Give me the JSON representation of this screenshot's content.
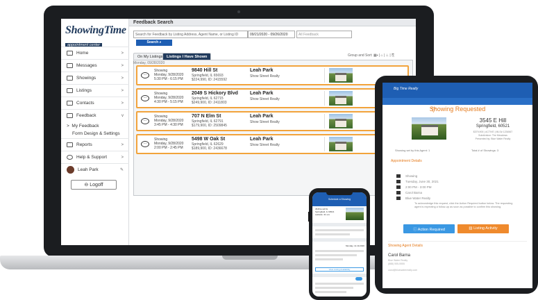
{
  "app": {
    "logo_main": "ShowingTime",
    "logo_sub": "appointment center",
    "page_title": "Feedback Search"
  },
  "sidebar": {
    "items": [
      {
        "label": "Home",
        "icon": "home-icon"
      },
      {
        "label": "Messages",
        "icon": "mail-icon"
      },
      {
        "label": "Showings",
        "icon": "calendar-icon"
      },
      {
        "label": "Listings",
        "icon": "listing-icon"
      },
      {
        "label": "Contacts",
        "icon": "contacts-icon"
      },
      {
        "label": "Feedback",
        "icon": "feedback-icon"
      }
    ],
    "sub_items": [
      "My Feedback",
      "Form Design & Settings"
    ],
    "items2": [
      {
        "label": "Reports",
        "icon": "reports-icon"
      },
      {
        "label": "Help & Support",
        "icon": "help-icon"
      }
    ],
    "user": "Leah Park",
    "logoff": "Logoff"
  },
  "search": {
    "placeholder": "Search for Feedback by Listing Address, Agent Name, or Listing ID",
    "date_range": "09/21/2020 - 09/26/2020",
    "filter_value": "All Feedback",
    "button": "Search"
  },
  "tabs": {
    "on_my_listings": "On My Listings",
    "listings_i_have_shown": "Listings I Have Shown"
  },
  "group_sort": "Group and Sort:",
  "day_label": "Monday, 09/28/2020",
  "cards": [
    {
      "status": "Showing",
      "date": "Monday, 9/28/2020",
      "time": "5:30 PM - 6:15 PM",
      "address": "9840 Hill St",
      "city": "Springfield, IL 65693",
      "price": "$224,990, ID: 2415592",
      "agent": "Leah Park",
      "office": "Show Street Realty"
    },
    {
      "status": "Showing",
      "date": "Monday, 9/28/2020",
      "time": "4:30 PM - 5:15 PM",
      "address": "2049 S Hickory Blvd",
      "city": "Springfield, IL 62715",
      "price": "$249,900, ID: 2411803",
      "agent": "Leah Park",
      "office": "Show Street Realty"
    },
    {
      "status": "Showing",
      "date": "Monday, 9/28/2020",
      "time": "3:45 PM - 4:30 PM",
      "address": "707 N Elm St",
      "city": "Springfield, IL 62791",
      "price": "$179,900, ID: 2509845",
      "agent": "Leah Park",
      "office": "Show Street Realty"
    },
    {
      "status": "Showing",
      "date": "Monday, 9/28/2020",
      "time": "2:00 PM - 2:45 PM",
      "address": "5498 W Oak St",
      "city": "Springfield, IL 62629",
      "price": "$189,900, ID: 2436678",
      "agent": "Leah Park",
      "office": "Show Street Realty"
    }
  ],
  "tablet": {
    "logo": "Big Time Realty",
    "title": "Showing Requested",
    "address": "3545 E Hill",
    "city": "Springfield, 60521",
    "meta": "$379,900 | ACTIVE | MLS# 1234567",
    "subdivision": "Subdivision: The Meadows",
    "presented": "Presented by: Blue Water Realty",
    "by_agent": "Showing set by this Agent: 1",
    "total_showings": "Total # of Showings: 3",
    "details_header": "Appointment Details",
    "rows": [
      "Showing",
      "Tuesday, June 30, 2021",
      "2:00 PM - 3:00 PM",
      "Carol Barna",
      "Blue Water Realty"
    ],
    "ack_text": "To acknowledge this request, click the Action Required button below. The requesting agent is expecting a follow-up as soon as possible to confirm this showing.",
    "btn_required": "Action Required",
    "btn_activity": "Listing Activity",
    "agent_header": "Showing Agent Details",
    "agent_name": "Carol Barna",
    "agent_office": "Blue Water Realty",
    "agent_phone": "(888) 555-5555",
    "agent_email": "carol@bluewaterrealty.com"
  },
  "phone": {
    "title": "Schedule a Showing",
    "address": "3545 E Hill St\nSpringfield, IL 60521\nLatitude: 41.xxx",
    "date_time": "Monday, 11.19.2020",
    "view_button": "View Listing Availability"
  }
}
